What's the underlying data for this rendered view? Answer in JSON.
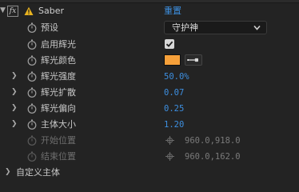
{
  "effect": {
    "fx_label": "fx",
    "name": "Saber",
    "reset_label": "重置"
  },
  "properties": [
    {
      "label": "预设",
      "type": "dropdown",
      "value": "守护神"
    },
    {
      "label": "启用辉光",
      "type": "checkbox",
      "checked": true
    },
    {
      "label": "辉光颜色",
      "type": "color",
      "color": "#f6a03a"
    },
    {
      "label": "辉光强度",
      "type": "number",
      "value": "50.0%"
    },
    {
      "label": "辉光扩散",
      "type": "number",
      "value": "0.07"
    },
    {
      "label": "辉光偏向",
      "type": "number",
      "value": "0.25"
    },
    {
      "label": "主体大小",
      "type": "number",
      "value": "1.20"
    },
    {
      "label": "开始位置",
      "type": "point",
      "value": "960.0,918.0",
      "disabled": true
    },
    {
      "label": "结束位置",
      "type": "point",
      "value": "960.0,162.0",
      "disabled": true
    }
  ],
  "group": {
    "label": "自定义主体"
  },
  "colors": {
    "accent": "#3d8fe0",
    "background": "#232323",
    "swatch": "#f6a03a"
  }
}
